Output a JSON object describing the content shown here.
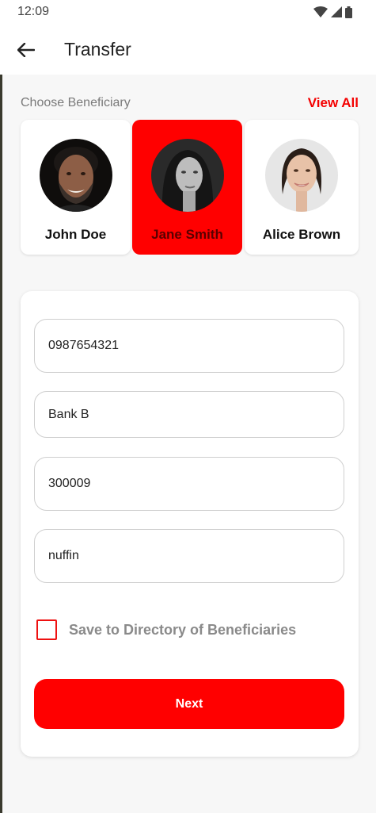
{
  "status_bar": {
    "time": "12:09",
    "icons": [
      "wifi-icon",
      "signal-icon",
      "battery-icon"
    ]
  },
  "app_bar": {
    "back_icon": "arrow-left-icon",
    "title": "Transfer"
  },
  "beneficiaries": {
    "label": "Choose Beneficiary",
    "view_all": "View All",
    "items": [
      {
        "name": "John Doe",
        "selected": false
      },
      {
        "name": "Jane Smith",
        "selected": true
      },
      {
        "name": "Alice Brown",
        "selected": false
      }
    ]
  },
  "form": {
    "account_number": "0987654321",
    "bank": "Bank B",
    "amount": "300009",
    "note": "nuffin",
    "save_label": "Save to Directory of Beneficiaries",
    "save_checked": false,
    "next_label": "Next"
  },
  "colors": {
    "accent": "#ff0000",
    "background": "#f7f7f7",
    "card": "#ffffff"
  }
}
